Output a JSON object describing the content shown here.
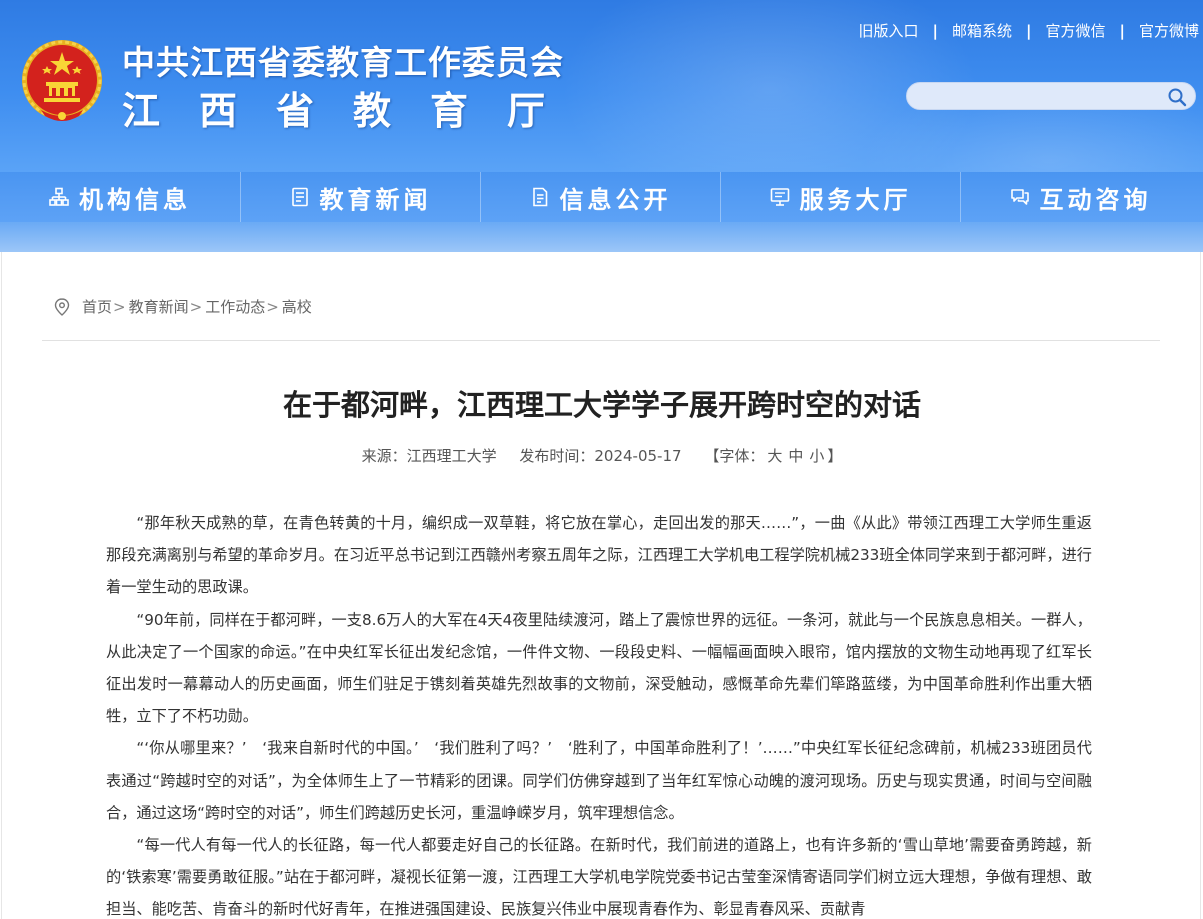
{
  "header": {
    "title_line1": "中共江西省委教育工作委员会",
    "title_line2": "江西省教育厅",
    "top_links": [
      "旧版入口",
      "邮箱系统",
      "官方微信",
      "官方微博"
    ],
    "separator": "|",
    "search": {
      "placeholder": "",
      "icon": "search-icon"
    },
    "colors": {
      "header_bg": "#3f8ef0",
      "nav_bg": "#5da2f6"
    }
  },
  "nav": {
    "items": [
      {
        "label": "机构信息",
        "icon": "org-chart-icon"
      },
      {
        "label": "教育新闻",
        "icon": "news-icon"
      },
      {
        "label": "信息公开",
        "icon": "document-icon"
      },
      {
        "label": "服务大厅",
        "icon": "monitor-icon"
      },
      {
        "label": "互动咨询",
        "icon": "chat-icon"
      }
    ]
  },
  "breadcrumb": {
    "icon": "location-pin-icon",
    "items": [
      "首页",
      "教育新闻",
      "工作动态",
      "高校"
    ],
    "separator": ">"
  },
  "article": {
    "title": "在于都河畔，江西理工大学学子展开跨时空的对话",
    "source": "来源：江西理工大学",
    "date": "发布时间：2024-05-17",
    "font_size_prefix": "【字体：",
    "font_sizes": [
      "大",
      "中",
      "小"
    ],
    "font_size_suffix": "】",
    "paragraphs": [
      "“那年秋天成熟的草，在青色转黄的十月，编织成一双草鞋，将它放在掌心，走回出发的那天……”，一曲《从此》带领江西理工大学师生重返那段充满离别与希望的革命岁月。在习近平总书记到江西赣州考察五周年之际，江西理工大学机电工程学院机械233班全体同学来到于都河畔，进行着一堂生动的思政课。",
      "“90年前，同样在于都河畔，一支8.6万人的大军在4天4夜里陆续渡河，踏上了震惊世界的远征。一条河，就此与一个民族息息相关。一群人，从此决定了一个国家的命运。”在中央红军长征出发纪念馆，一件件文物、一段段史料、一幅幅画面映入眼帘，馆内摆放的文物生动地再现了红军长征出发时一幕幕动人的历史画面，师生们驻足于镌刻着英雄先烈故事的文物前，深受触动，感慨革命先辈们筚路蓝缕，为中国革命胜利作出重大牺牲，立下了不朽功勋。",
      "“‘你从哪里来？’　‘我来自新时代的中国。’　‘我们胜利了吗？’　‘胜利了，中国革命胜利了！’……”中央红军长征纪念碑前，机械233班团员代表通过“跨越时空的对话”，为全体师生上了一节精彩的团课。同学们仿佛穿越到了当年红军惊心动魄的渡河现场。历史与现实贯通，时间与空间融合，通过这场“跨时空的对话”，师生们跨越历史长河，重温峥嵘岁月，筑牢理想信念。",
      "“每一代人有每一代人的长征路，每一代人都要走好自己的长征路。在新时代，我们前进的道路上，也有许多新的‘雪山草地’需要奋勇跨越，新的‘铁索寒’需要勇敢征服。”站在于都河畔，凝视长征第一渡，江西理工大学机电学院党委书记古莹奎深情寄语同学们树立远大理想，争做有理想、敢担当、能吃苦、肯奋斗的新时代好青年，在推进强国建设、民族复兴伟业中展现青春作为、彰显青春风采、贡献青"
    ]
  }
}
